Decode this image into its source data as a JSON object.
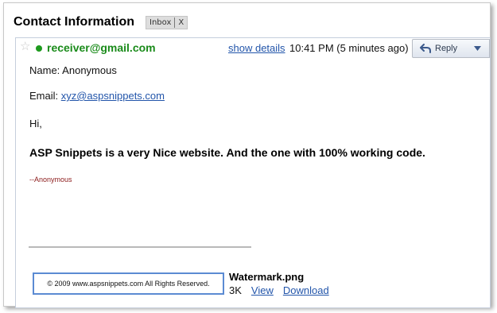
{
  "subject": "Contact Information",
  "label": {
    "name": "Inbox",
    "remove": "X"
  },
  "message": {
    "star_icon": "star-outline",
    "sender": "receiver@gmail.com",
    "show_details": "show details",
    "time": "10:41 PM (5 minutes ago)",
    "reply_label": "Reply",
    "body": {
      "name_line": "Name: Anonymous",
      "email_label": "Email: ",
      "email_value": "xyz@aspsnippets.com",
      "greeting": "Hi,",
      "bold_line": "ASP Snippets is a very Nice website. And the one with 100% working code.",
      "signature": "--Anonymous"
    }
  },
  "attachment": {
    "thumbnail_text": "© 2009 www.aspsnippets.com  All Rights Reserved.",
    "filename": "Watermark.png",
    "size": "3K",
    "view": "View",
    "download": "Download"
  },
  "colors": {
    "sender": "#1a8b1a",
    "link": "#2255aa",
    "signature": "#8b1a1a",
    "thumb_border": "#5b8bd3"
  }
}
